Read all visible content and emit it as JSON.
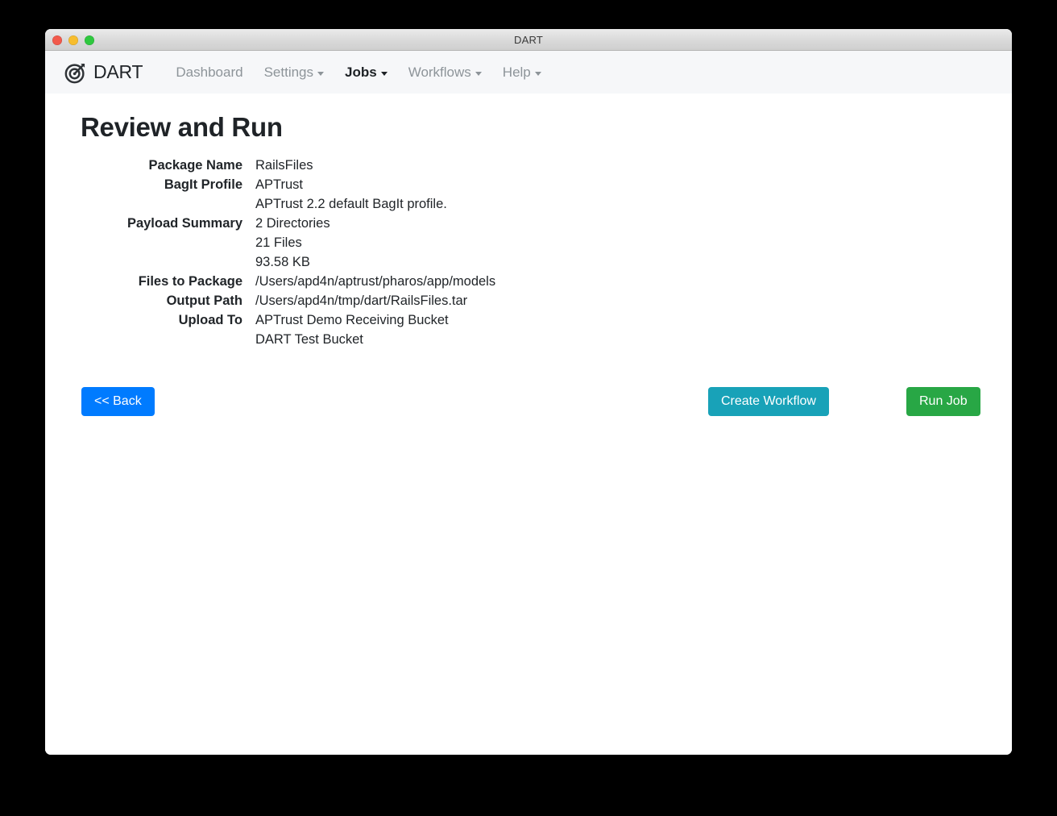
{
  "window": {
    "title": "DART",
    "traffic_lights": [
      "close-button",
      "minimize-button",
      "maximize-button"
    ]
  },
  "navbar": {
    "brand": {
      "label": "DART",
      "icon": "target-arrow-logo-icon"
    },
    "items": [
      {
        "label": "Dashboard",
        "has_caret": false,
        "active": false
      },
      {
        "label": "Settings",
        "has_caret": true,
        "active": false
      },
      {
        "label": "Jobs",
        "has_caret": true,
        "active": true
      },
      {
        "label": "Workflows",
        "has_caret": true,
        "active": false
      },
      {
        "label": "Help",
        "has_caret": true,
        "active": false
      }
    ]
  },
  "main": {
    "page_title": "Review and Run",
    "rows": [
      {
        "label": "Package Name",
        "values": [
          "RailsFiles"
        ]
      },
      {
        "label": "BagIt Profile",
        "values": [
          "APTrust",
          "APTrust 2.2 default BagIt profile."
        ]
      },
      {
        "label": "Payload Summary",
        "values": [
          "2 Directories",
          "21 Files",
          "93.58 KB"
        ]
      },
      {
        "label": "Files to Package",
        "values": [
          "/Users/apd4n/aptrust/pharos/app/models"
        ]
      },
      {
        "label": "Output Path",
        "values": [
          "/Users/apd4n/tmp/dart/RailsFiles.tar"
        ]
      },
      {
        "label": "Upload To",
        "values": [
          "APTrust Demo Receiving Bucket",
          "DART Test Bucket"
        ]
      }
    ],
    "buttons": {
      "back": "<< Back",
      "create_workflow": "Create Workflow",
      "run_job": "Run Job"
    }
  },
  "colors": {
    "primary_blue": "#007bff",
    "info_teal": "#18a2b8",
    "success_green": "#28a745",
    "navbar_bg": "#f6f7f9",
    "nav_muted": "#8d9499",
    "text": "#212529"
  }
}
